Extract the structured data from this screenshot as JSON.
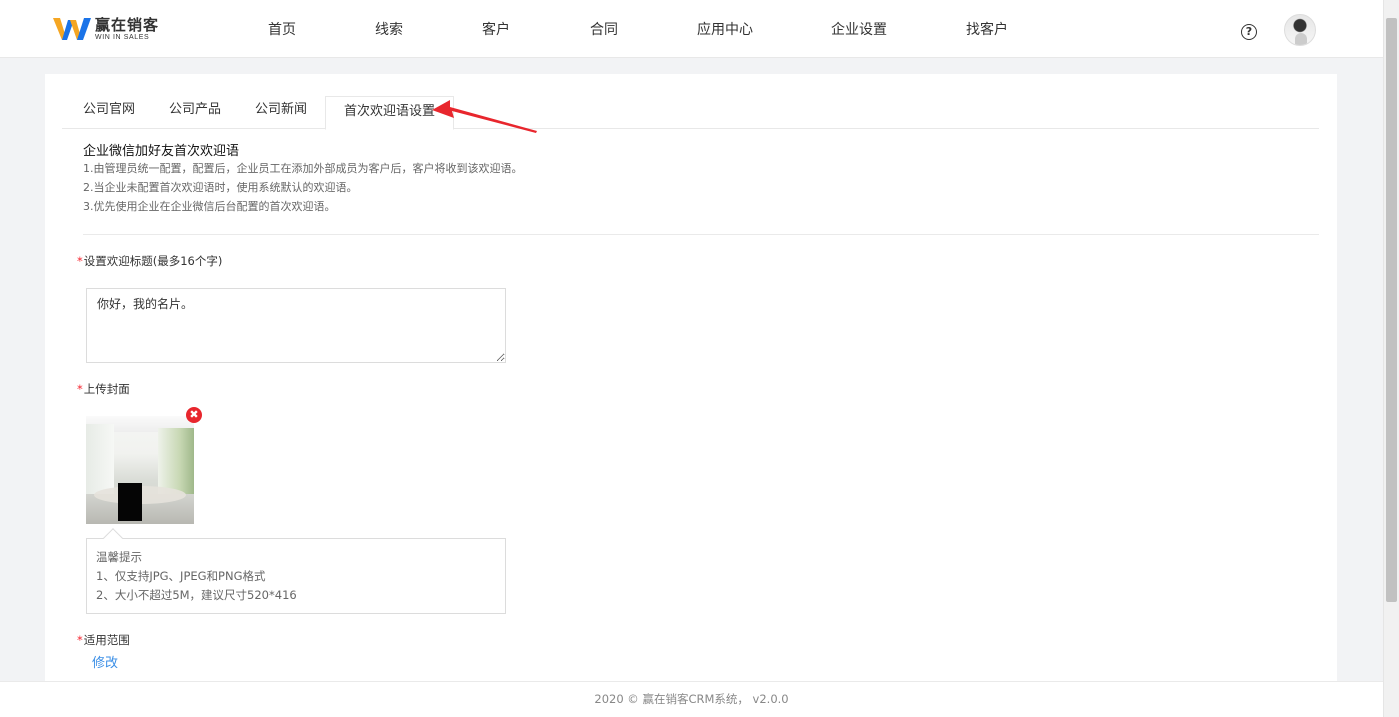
{
  "header": {
    "logo_cn": "赢在销客",
    "logo_en": "WIN IN SALES",
    "nav": [
      {
        "label": "首页"
      },
      {
        "label": "线索"
      },
      {
        "label": "客户"
      },
      {
        "label": "合同"
      },
      {
        "label": "应用中心"
      },
      {
        "label": "企业设置"
      },
      {
        "label": "找客户"
      }
    ],
    "help_glyph": "?",
    "icons": {
      "help": "question-circle-icon",
      "avatar": "user-avatar"
    }
  },
  "tabs": [
    {
      "label": "公司官网",
      "active": false
    },
    {
      "label": "公司产品",
      "active": false
    },
    {
      "label": "公司新闻",
      "active": false
    },
    {
      "label": "首次欢迎语设置",
      "active": true
    }
  ],
  "intro": {
    "title": "企业微信加好友首次欢迎语",
    "lines": [
      "1.由管理员统一配置，配置后，企业员工在添加外部成员为客户后，客户将收到该欢迎语。",
      "2.当企业未配置首次欢迎语时，使用系统默认的欢迎语。",
      "3.优先使用企业在企业微信后台配置的首次欢迎语。"
    ]
  },
  "form": {
    "required_mark": "*",
    "welcome_title_label": "设置欢迎标题(最多16个字)",
    "welcome_title_value": "你好，我的名片。",
    "cover_label": "上传封面",
    "remove_glyph": "✖",
    "tip": {
      "title": "温馨提示",
      "line1": "1、仅支持JPG、JPEG和PNG格式",
      "line2": "2、大小不超过5M，建议尺寸520*416"
    },
    "scope_label": "适用范围",
    "modify_link": "修改"
  },
  "footer": {
    "text": "2020 © 赢在销客CRM系统， v2.0.0"
  },
  "colors": {
    "accent_link": "#3a8ee6",
    "required": "#f5222d",
    "arrow": "#e8262d",
    "logo_blue": "#1a73e8",
    "logo_orange": "#f5a623"
  }
}
